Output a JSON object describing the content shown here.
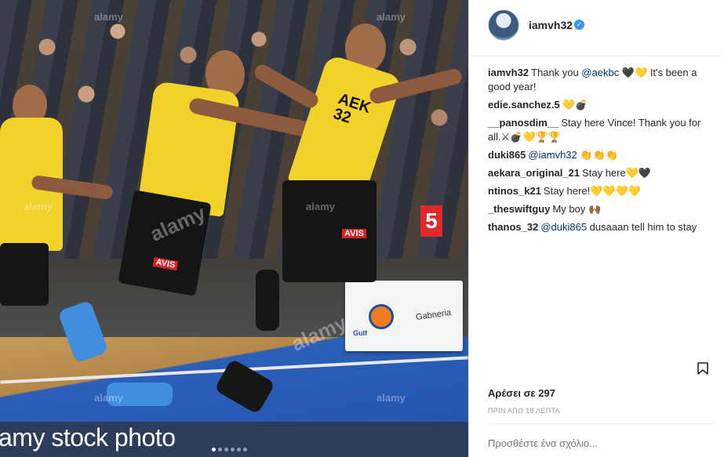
{
  "photo": {
    "watermark_caption": "amy stock photo",
    "watermark_repeat": "alamy",
    "jersey_text": "AEK 32",
    "sponsor": "AVIS",
    "board_number": "5",
    "board_brand_1": "Gulf",
    "board_brand_2": "Gabneria",
    "carousel": {
      "total": 6,
      "active_index": 0
    }
  },
  "post_header": {
    "username": "iamvh32",
    "verified": true
  },
  "comments": [
    {
      "user": "iamvh32",
      "segments": [
        {
          "text": "Thank you ",
          "mention": false
        },
        {
          "text": "@aekbc",
          "mention": true
        },
        {
          "text": " 🖤💛 It's been a good year!",
          "mention": false
        }
      ]
    },
    {
      "user": "edie.sanchez.5",
      "segments": [
        {
          "text": "💛💣",
          "mention": false
        }
      ]
    },
    {
      "user": "__panosdim__",
      "segments": [
        {
          "text": "Stay here Vince! Thank you for all.⚔💣💛🏆🏆",
          "mention": false
        }
      ]
    },
    {
      "user": "duki865",
      "segments": [
        {
          "text": "@iamvh32",
          "mention": true
        },
        {
          "text": " 👏👏👏",
          "mention": false
        }
      ]
    },
    {
      "user": "aekara_original_21",
      "segments": [
        {
          "text": "Stay here💛🖤",
          "mention": false
        }
      ]
    },
    {
      "user": "ntinos_k21",
      "segments": [
        {
          "text": "Stay here!💛💛💛💛",
          "mention": false
        }
      ]
    },
    {
      "user": "_theswiftguy",
      "segments": [
        {
          "text": "My boy 🙌🏾",
          "mention": false
        }
      ]
    },
    {
      "user": "thanos_32",
      "segments": [
        {
          "text": "@duki865",
          "mention": true
        },
        {
          "text": " dusaaan tell him to stay",
          "mention": false
        }
      ]
    }
  ],
  "likes_text": "Αρέσει σε 297",
  "timestamp": "ΠΡΙΝ ΑΠΟ 18 ΛΕΠΤΑ",
  "add_comment_placeholder": "Προσθέστε ένα σχόλιο...",
  "icons": {
    "verified": "verified-badge-icon",
    "bookmark": "bookmark-icon"
  },
  "colors": {
    "mention": "#003569",
    "verified": "#3897f0",
    "text": "#262626",
    "muted": "#999999"
  }
}
